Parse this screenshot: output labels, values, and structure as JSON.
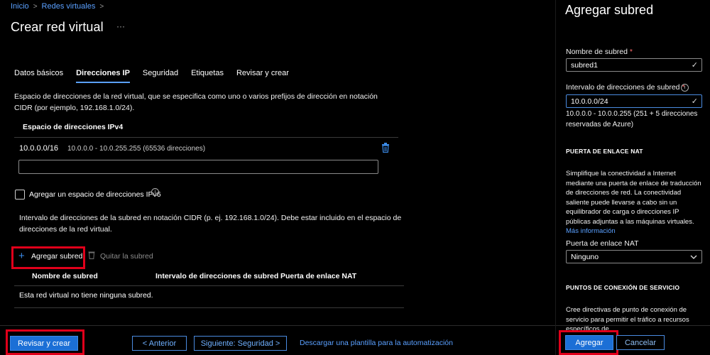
{
  "breadcrumb": {
    "home": "Inicio",
    "current": "Redes virtuales"
  },
  "page": {
    "title": "Crear red virtual",
    "more": "···"
  },
  "tabs": [
    {
      "label": "Datos básicos"
    },
    {
      "label": "Direcciones IP",
      "active": true
    },
    {
      "label": "Seguridad"
    },
    {
      "label": "Etiquetas"
    },
    {
      "label": "Revisar y crear"
    }
  ],
  "address_space": {
    "description": "Espacio de direcciones de la red virtual, que se especifica como uno o varios prefijos de dirección en notación CIDR (por ejemplo, 192.168.1.0/24).",
    "header": "Espacio de direcciones IPv4",
    "entry_cidr": "10.0.0.0/16",
    "entry_range": "10.0.0.0 - 10.0.255.255 (65536 direcciones)",
    "new_value": ""
  },
  "ipv6": {
    "label": "Agregar un espacio de direcciones IPv6",
    "checked": false
  },
  "subnets": {
    "description": "Intervalo de direcciones de la subred en notación CIDR (p. ej. 192.168.1.0/24). Debe estar incluido en el espacio de direcciones de la red virtual.",
    "add_label": "Agregar subred",
    "remove_label": "Quitar la subred",
    "columns": [
      "Nombre de subred",
      "Intervalo de direcciones de subred",
      "Puerta de enlace NAT"
    ],
    "empty": "Esta red virtual no tiene ninguna subred."
  },
  "footer": {
    "review": "Revisar y crear",
    "previous": "< Anterior",
    "next": "Siguiente: Seguridad >",
    "download": "Descargar una plantilla para la automatización"
  },
  "panel": {
    "title": "Agregar subred",
    "name_label": "Nombre de subred",
    "name_value": "subred1",
    "range_label": "Intervalo de direcciones de subred",
    "range_value": "10.0.0.0/24",
    "range_note": "10.0.0.0 - 10.0.0.255 (251 + 5 direcciones reservadas de Azure)",
    "nat_heading": "PUERTA DE ENLACE NAT",
    "nat_desc": "Simplifique la conectividad a Internet mediante una puerta de enlace de traducción de direcciones de red. La conectividad saliente puede llevarse a cabo sin un equilibrador de carga o direcciones IP públicas adjuntas a las máquinas virtuales.",
    "nat_more": "Más información",
    "nat_label": "Puerta de enlace NAT",
    "nat_value": "Ninguno",
    "endpoints_heading": "PUNTOS DE CONEXIÓN DE SERVICIO",
    "endpoints_desc": "Cree directivas de punto de conexión de servicio para permitir el tráfico a recursos específicos de",
    "add_button": "Agregar",
    "cancel_button": "Cancelar"
  },
  "colors": {
    "accent": "#1b6fd6",
    "link": "#5aa0ff",
    "highlight": "#e0001a"
  }
}
